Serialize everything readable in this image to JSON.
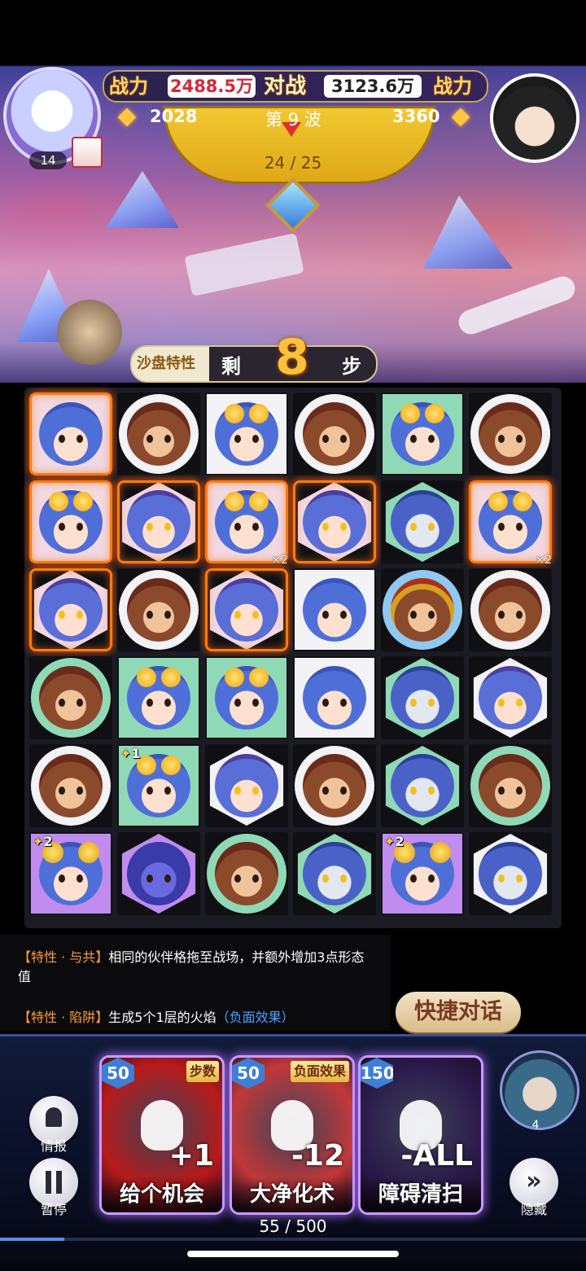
{
  "hud": {
    "power_label_left": "战力",
    "power_left": "2488.5万",
    "vs_label": "对战",
    "power_right": "3123.6万",
    "power_label_right": "战力",
    "score_left": "2028",
    "wave_label": "第 9 波",
    "score_right": "3360",
    "wave_progress": "24 / 25",
    "left_avatar_level": "14"
  },
  "steps": {
    "sandbox_trait_label": "沙盘特性",
    "remaining_prefix": "剩",
    "remaining_count": "8",
    "remaining_suffix": "步"
  },
  "board": {
    "rows": [
      [
        {
          "char": "girl",
          "shape": "square",
          "color": "pink",
          "fire": true
        },
        {
          "char": "lion",
          "shape": "circle",
          "color": "white"
        },
        {
          "char": "goggle",
          "shape": "square",
          "color": "white"
        },
        {
          "char": "lion",
          "shape": "circle",
          "color": "white"
        },
        {
          "char": "goggle",
          "shape": "square",
          "color": "green"
        },
        {
          "char": "lion",
          "shape": "circle",
          "color": "white"
        }
      ],
      [
        {
          "char": "goggle",
          "shape": "square",
          "color": "pink",
          "fire": true
        },
        {
          "char": "cat",
          "shape": "hex",
          "color": "pink",
          "fire": true
        },
        {
          "char": "goggle",
          "shape": "square",
          "color": "pink",
          "fire": true,
          "mult": "×2"
        },
        {
          "char": "cat",
          "shape": "hex",
          "color": "pink",
          "fire": true
        },
        {
          "char": "pale",
          "shape": "hex",
          "color": "green"
        },
        {
          "char": "goggle",
          "shape": "square",
          "color": "pink",
          "fire": true,
          "mult": "×2"
        }
      ],
      [
        {
          "char": "cat",
          "shape": "hex",
          "color": "pink",
          "fire": true
        },
        {
          "char": "lion",
          "shape": "circle",
          "color": "white"
        },
        {
          "char": "cat",
          "shape": "hex",
          "color": "pink",
          "fire": true
        },
        {
          "char": "girl",
          "shape": "square",
          "color": "white"
        },
        {
          "char": "helm",
          "shape": "circle",
          "color": "blue"
        },
        {
          "char": "lion",
          "shape": "circle",
          "color": "white"
        }
      ],
      [
        {
          "char": "lion",
          "shape": "circle",
          "color": "green"
        },
        {
          "char": "goggle",
          "shape": "square",
          "color": "green"
        },
        {
          "char": "goggle",
          "shape": "square",
          "color": "green"
        },
        {
          "char": "girl",
          "shape": "square",
          "color": "white"
        },
        {
          "char": "pale",
          "shape": "hex",
          "color": "green"
        },
        {
          "char": "cat",
          "shape": "hex",
          "color": "white"
        }
      ],
      [
        {
          "char": "lion",
          "shape": "circle",
          "color": "white"
        },
        {
          "char": "goggle",
          "shape": "square",
          "color": "green",
          "badge": "1"
        },
        {
          "char": "cat",
          "shape": "hex",
          "color": "white"
        },
        {
          "char": "lion",
          "shape": "circle",
          "color": "white"
        },
        {
          "char": "pale",
          "shape": "hex",
          "color": "green"
        },
        {
          "char": "lion",
          "shape": "circle",
          "color": "green"
        }
      ],
      [
        {
          "char": "bun",
          "shape": "square",
          "color": "purple",
          "badge": "2"
        },
        {
          "char": "mask",
          "shape": "hex",
          "color": "purple"
        },
        {
          "char": "lion",
          "shape": "circle",
          "color": "green"
        },
        {
          "char": "pale",
          "shape": "hex",
          "color": "green"
        },
        {
          "char": "bun",
          "shape": "square",
          "color": "purple",
          "badge": "2"
        },
        {
          "char": "pale",
          "shape": "hex",
          "color": "white"
        }
      ]
    ]
  },
  "traits": {
    "t1_tag": "【特性 · 与共】",
    "t1_text": "相同的伙伴格拖至战场，并额外增加3点形态值",
    "t2_tag": "【特性 · 陷阱】",
    "t2_text": "生成5个1层的火焰",
    "t2_neg": "（负面效果）"
  },
  "quick_chat": "快捷对话",
  "cards": [
    {
      "cost": "50",
      "type": "步数",
      "effect": "+1",
      "name": "给个机会",
      "bg": "#b81a1a"
    },
    {
      "cost": "50",
      "type": "负面效果",
      "effect": "-12",
      "name": "大净化术",
      "bg": "#c23838"
    },
    {
      "cost": "150",
      "type": "",
      "effect": "-ALL",
      "name": "障碍清扫",
      "bg": "#2a1a4a"
    }
  ],
  "side": {
    "intel_label": "情报",
    "pause_label": "暂停",
    "hide_label": "隐藏",
    "companion_level": "4"
  },
  "energy": {
    "text": "55 / 500",
    "fraction": 0.11
  },
  "colors": {
    "gold": "#ffd66b",
    "fire": "#ff7a10",
    "accent_blue": "#4f8ff0"
  }
}
